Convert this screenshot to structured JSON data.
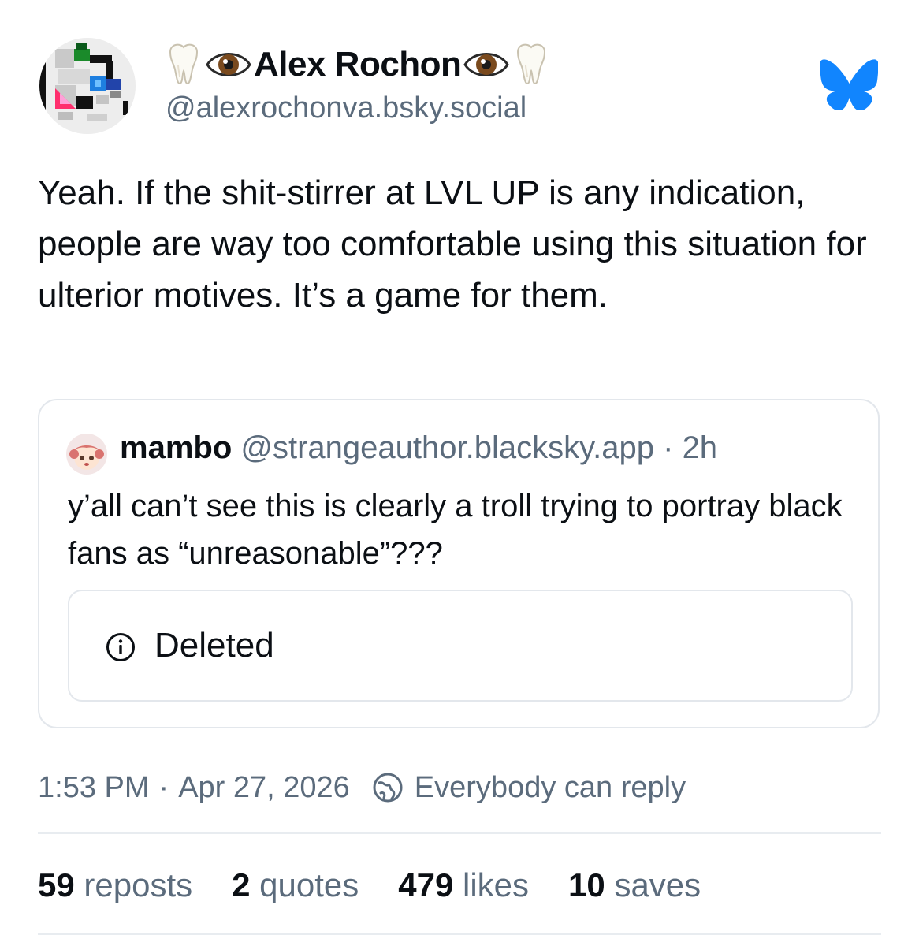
{
  "author": {
    "display_name": "Alex Rochon",
    "name_emoji": [
      "tooth-emoji",
      "eye-emoji"
    ],
    "handle": "@alexrochonva.bsky.social"
  },
  "post": {
    "text": "Yeah. If the shit-stirrer at LVL UP is any indication, people are way too comfortable using this situation for ulterior motives. It’s a game for them."
  },
  "quote": {
    "name": "mambo",
    "handle": "@strangeauthor.blacksky.app",
    "separator": "·",
    "time": "2h",
    "text": "y’all can’t see this is clearly a troll trying to portray black fans as “unreasonable”???",
    "embed": {
      "status_label": "Deleted"
    }
  },
  "meta": {
    "time": "1:53 PM",
    "separator": "·",
    "date": "Apr 27, 2026",
    "reply_setting": "Everybody can reply"
  },
  "stats": [
    {
      "count": "59",
      "label": "reposts"
    },
    {
      "count": "2",
      "label": "quotes"
    },
    {
      "count": "479",
      "label": "likes"
    },
    {
      "count": "10",
      "label": "saves"
    }
  ],
  "colors": {
    "brand": "#1185fe",
    "text": "#0b0f14",
    "muted": "#5b6b7c",
    "border": "#e3e7ec"
  },
  "icons": {
    "platform_logo": "bluesky-butterfly-icon",
    "info": "info-icon",
    "reply_setting": "globe-icon"
  }
}
